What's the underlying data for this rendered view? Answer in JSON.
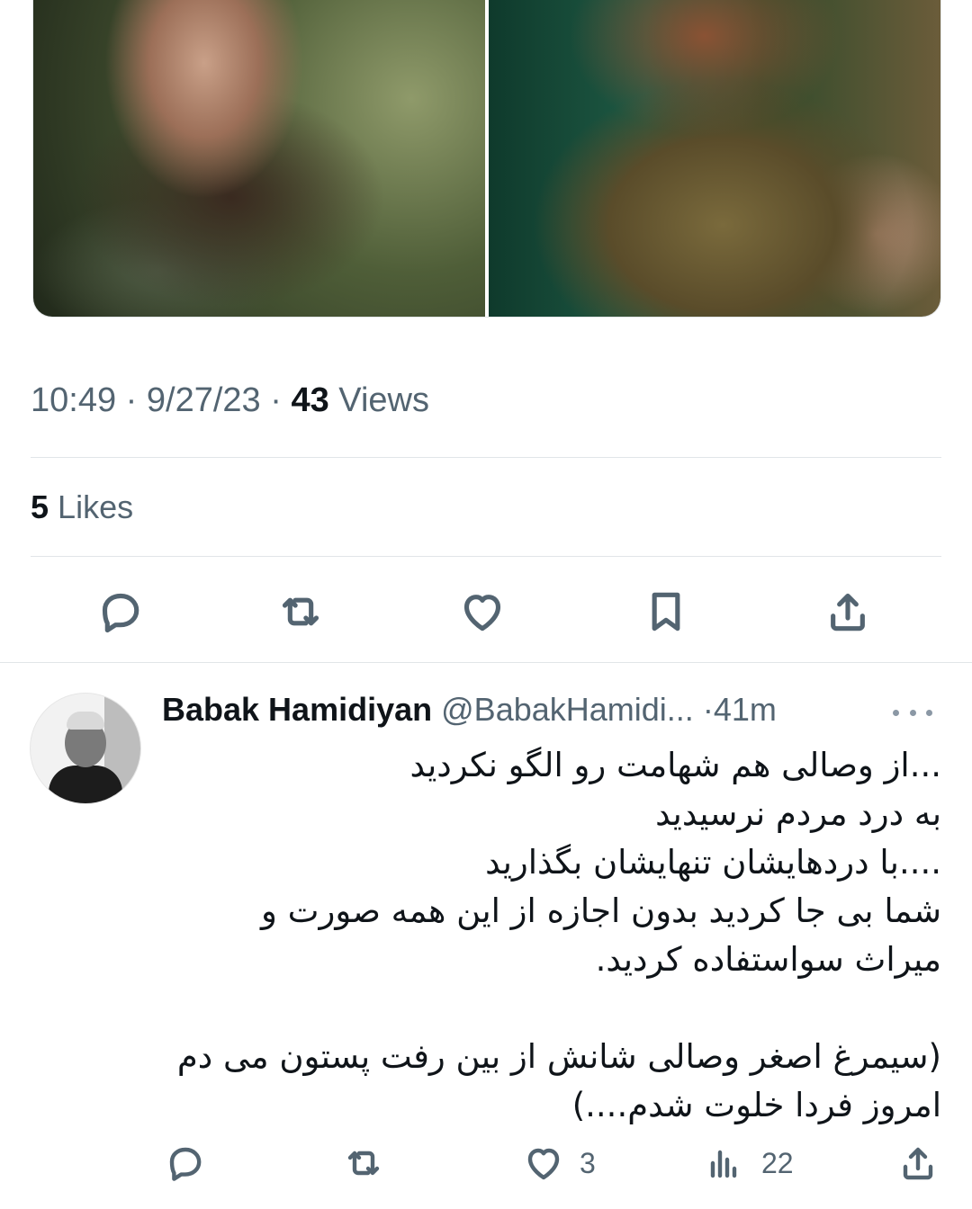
{
  "tweet": {
    "time": "10:49",
    "date": "9/27/23",
    "views_count": "43",
    "views_label": "Views",
    "likes_count": "5",
    "likes_label": "Likes",
    "separator": "·",
    "icons": [
      "reply-icon",
      "retweet-icon",
      "like-icon",
      "bookmark-icon",
      "share-icon"
    ]
  },
  "reply": {
    "name": "Babak Hamidiyan",
    "handle": "@BabakHamidi...",
    "time": "41m",
    "separator": "·",
    "lines": [
      "...از وصالی هم شهامت رو الگو نکردید",
      "به درد مردم نرسیدید",
      "....با دردهایشان تنهایشان بگذارید",
      "شما بی جا کردید بدون اجازه از این همه صورت و",
      "میراث سواستفاده کردید.",
      "",
      "(سیمرغ اصغر وصالی شانش از بین رفت پستون می دم",
      "امروز فردا خلوت شدم....)"
    ],
    "likes": "3",
    "views": "22"
  }
}
